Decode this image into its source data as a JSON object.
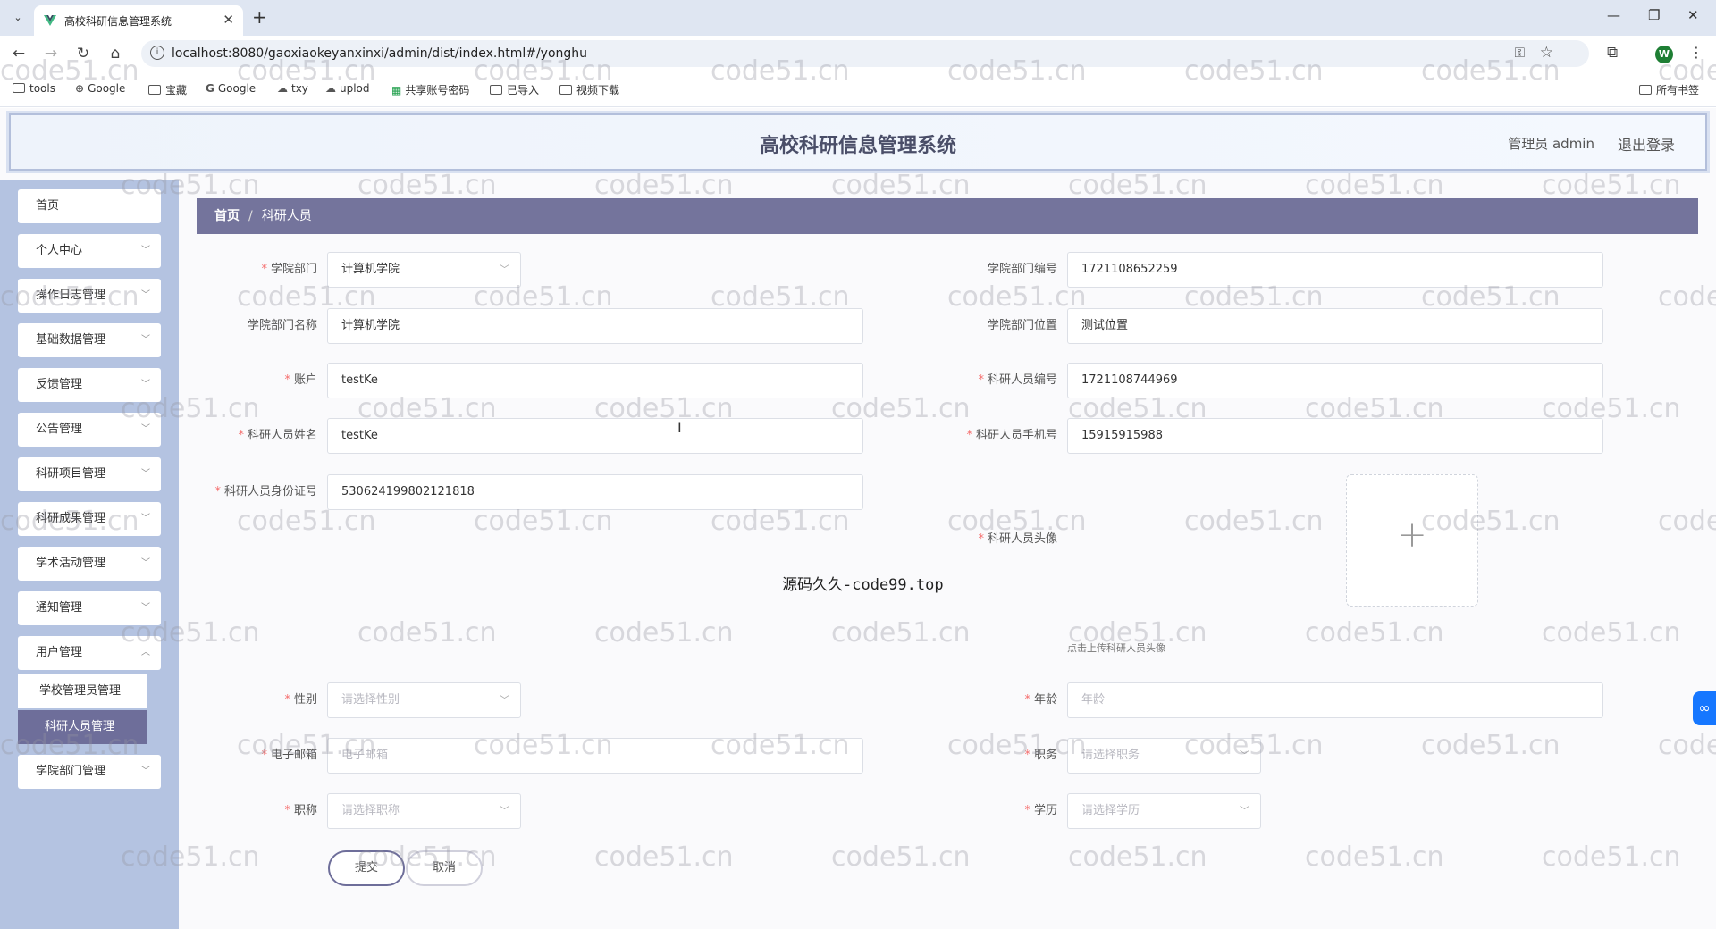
{
  "browser": {
    "tab_title": "高校科研信息管理系统",
    "tab_close": "✕",
    "new_tab": "+",
    "url": "localhost:8080/gaoxiaokeyanxinxi/admin/dist/index.html#/yonghu",
    "profile_initial": "W",
    "bookmarks": [
      "tools",
      "Google",
      "宝藏",
      "Google",
      "txy",
      "uplod",
      "共享账号密码",
      "已导入",
      "视频下载"
    ],
    "all_bookmarks": "所有书签"
  },
  "header": {
    "title": "高校科研信息管理系统",
    "user": "管理员 admin",
    "logout": "退出登录"
  },
  "sidebar": {
    "items": [
      "首页",
      "个人中心",
      "操作日志管理",
      "基础数据管理",
      "反馈管理",
      "公告管理",
      "科研项目管理",
      "科研成果管理",
      "学术活动管理",
      "通知管理",
      "用户管理"
    ],
    "sub_items": [
      "学校管理员管理",
      "科研人员管理"
    ],
    "last_item": "学院部门管理"
  },
  "breadcrumb": {
    "home": "首页",
    "sep": "/",
    "current": "科研人员"
  },
  "form": {
    "college_label": "学院部门",
    "college_value": "计算机学院",
    "college_no_label": "学院部门编号",
    "college_no_value": "1721108652259",
    "college_name_label": "学院部门名称",
    "college_name_value": "计算机学院",
    "college_loc_label": "学院部门位置",
    "college_loc_value": "测试位置",
    "account_label": "账户",
    "account_value": "testKe",
    "staff_no_label": "科研人员编号",
    "staff_no_value": "1721108744969",
    "name_label": "科研人员姓名",
    "name_value": "testKe",
    "phone_label": "科研人员手机号",
    "phone_value": "15915915988",
    "idcard_label": "科研人员身份证号",
    "idcard_value": "530624199802121818",
    "avatar_label": "科研人员头像",
    "avatar_tip": "点击上传科研人员头像",
    "gender_label": "性别",
    "gender_placeholder": "请选择性别",
    "age_label": "年龄",
    "age_placeholder": "年龄",
    "email_label": "电子邮箱",
    "email_placeholder": "电子邮箱",
    "post_label": "职务",
    "post_placeholder": "请选择职务",
    "title_label": "职称",
    "title_placeholder": "请选择职称",
    "degree_label": "学历",
    "degree_placeholder": "请选择学历",
    "submit": "提交",
    "cancel": "取消"
  },
  "overlay_text": "源码久久-code99.top",
  "watermark": "code51.cn",
  "colors": {
    "sidebar_bg": "#b4c3e1",
    "accent": "#74749c",
    "required": "#f56c6c"
  }
}
